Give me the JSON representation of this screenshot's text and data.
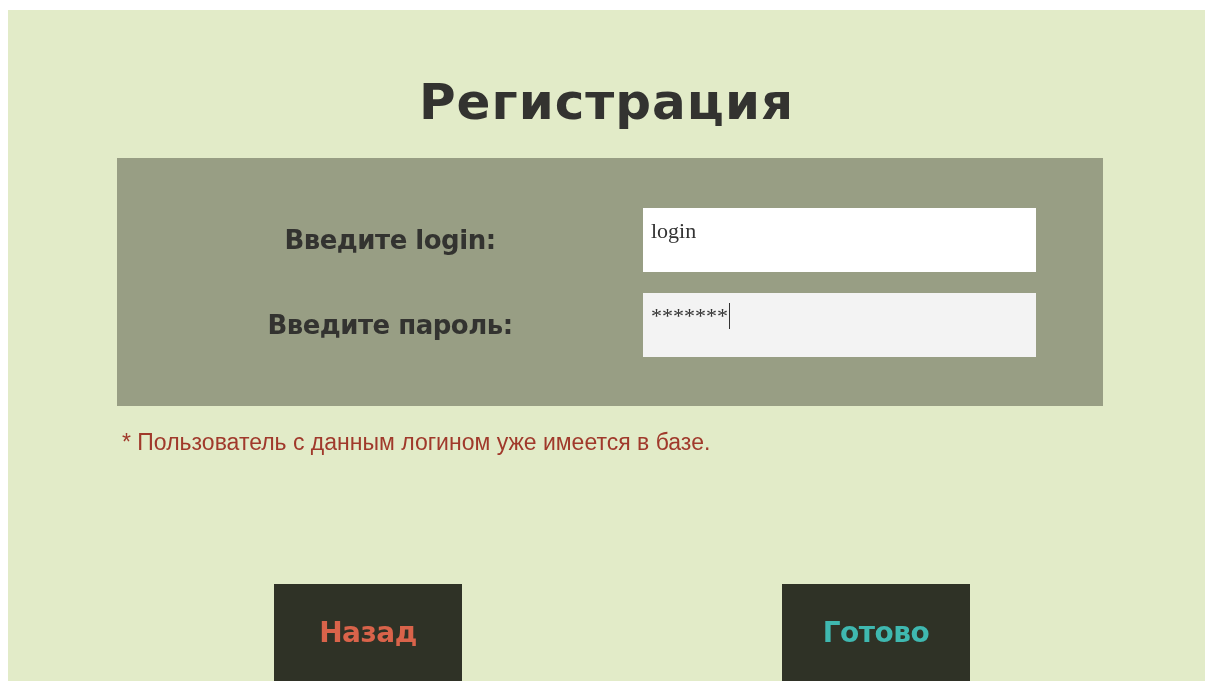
{
  "title": "Регистрация",
  "form": {
    "fields": [
      {
        "label": "Введите login:",
        "value": "login",
        "focused": false
      },
      {
        "label": "Введите пароль:",
        "value": "*******",
        "focused": true
      }
    ]
  },
  "error": "* Пользователь с данным логином уже имеется в базе.",
  "buttons": [
    {
      "label": "Назад",
      "kind": "back"
    },
    {
      "label": "Готово",
      "kind": "done"
    }
  ]
}
